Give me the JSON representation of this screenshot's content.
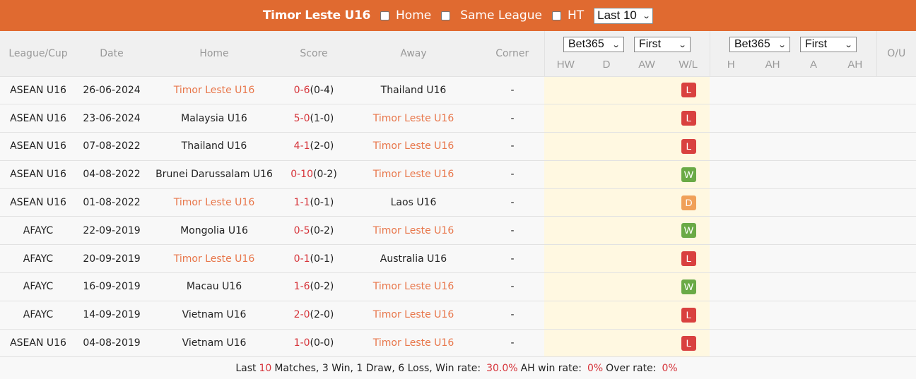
{
  "topbar": {
    "team": "Timor Leste U16",
    "filters": [
      {
        "label": "Home",
        "checked": false
      },
      {
        "label": "Same League",
        "checked": false
      },
      {
        "label": "HT",
        "checked": false
      }
    ],
    "range_select": "Last 10"
  },
  "columns": {
    "league": "League/Cup",
    "date": "Date",
    "home": "Home",
    "score": "Score",
    "away": "Away",
    "corner": "Corner",
    "ou": "O/U",
    "odds1": {
      "bookmaker": "Bet365",
      "type": "First",
      "sub": [
        "HW",
        "D",
        "AW",
        "W/L"
      ]
    },
    "odds2": {
      "bookmaker": "Bet365",
      "type": "First",
      "sub": [
        "H",
        "AH",
        "A",
        "AH"
      ]
    }
  },
  "colors": {
    "header_bg": "#e06a30",
    "highlight_team": "#e8764a",
    "score_red": "#d6343a",
    "win": "#6aaa46",
    "loss": "#d9413f",
    "draw": "#f0a058",
    "odds_bg": "#fff8e1"
  },
  "matches": [
    {
      "league": "ASEAN U16",
      "date": "26-06-2024",
      "home": "Timor Leste U16",
      "home_hl": true,
      "ft": "0-6",
      "ht": "(0-4)",
      "away": "Thailand U16",
      "away_hl": false,
      "corner": "-",
      "result": "L"
    },
    {
      "league": "ASEAN U16",
      "date": "23-06-2024",
      "home": "Malaysia U16",
      "home_hl": false,
      "ft": "5-0",
      "ht": "(1-0)",
      "away": "Timor Leste U16",
      "away_hl": true,
      "corner": "-",
      "result": "L"
    },
    {
      "league": "ASEAN U16",
      "date": "07-08-2022",
      "home": "Thailand U16",
      "home_hl": false,
      "ft": "4-1",
      "ht": "(2-0)",
      "away": "Timor Leste U16",
      "away_hl": true,
      "corner": "-",
      "result": "L"
    },
    {
      "league": "ASEAN U16",
      "date": "04-08-2022",
      "home": "Brunei Darussalam U16",
      "home_hl": false,
      "ft": "0-10",
      "ht": "(0-2)",
      "away": "Timor Leste U16",
      "away_hl": true,
      "corner": "-",
      "result": "W"
    },
    {
      "league": "ASEAN U16",
      "date": "01-08-2022",
      "home": "Timor Leste U16",
      "home_hl": true,
      "ft": "1-1",
      "ht": "(0-1)",
      "away": "Laos U16",
      "away_hl": false,
      "corner": "-",
      "result": "D"
    },
    {
      "league": "AFAYC",
      "date": "22-09-2019",
      "home": "Mongolia U16",
      "home_hl": false,
      "ft": "0-5",
      "ht": "(0-2)",
      "away": "Timor Leste U16",
      "away_hl": true,
      "corner": "-",
      "result": "W"
    },
    {
      "league": "AFAYC",
      "date": "20-09-2019",
      "home": "Timor Leste U16",
      "home_hl": true,
      "ft": "0-1",
      "ht": "(0-1)",
      "away": "Australia U16",
      "away_hl": false,
      "corner": "-",
      "result": "L"
    },
    {
      "league": "AFAYC",
      "date": "16-09-2019",
      "home": "Macau U16",
      "home_hl": false,
      "ft": "1-6",
      "ht": "(0-2)",
      "away": "Timor Leste U16",
      "away_hl": true,
      "corner": "-",
      "result": "W"
    },
    {
      "league": "AFAYC",
      "date": "14-09-2019",
      "home": "Vietnam U16",
      "home_hl": false,
      "ft": "2-0",
      "ht": "(2-0)",
      "away": "Timor Leste U16",
      "away_hl": true,
      "corner": "-",
      "result": "L"
    },
    {
      "league": "ASEAN U16",
      "date": "04-08-2019",
      "home": "Vietnam U16",
      "home_hl": false,
      "ft": "1-0",
      "ht": "(0-0)",
      "away": "Timor Leste U16",
      "away_hl": true,
      "corner": "-",
      "result": "L"
    }
  ],
  "summary": {
    "prefix": "Last",
    "count": "10",
    "record": "Matches, 3 Win, 1 Draw, 6 Loss, Win rate:",
    "win_rate": "30.0%",
    "ah_label": "AH win rate:",
    "ah_rate": "0%",
    "over_label": "Over rate:",
    "over_rate": "0%"
  }
}
